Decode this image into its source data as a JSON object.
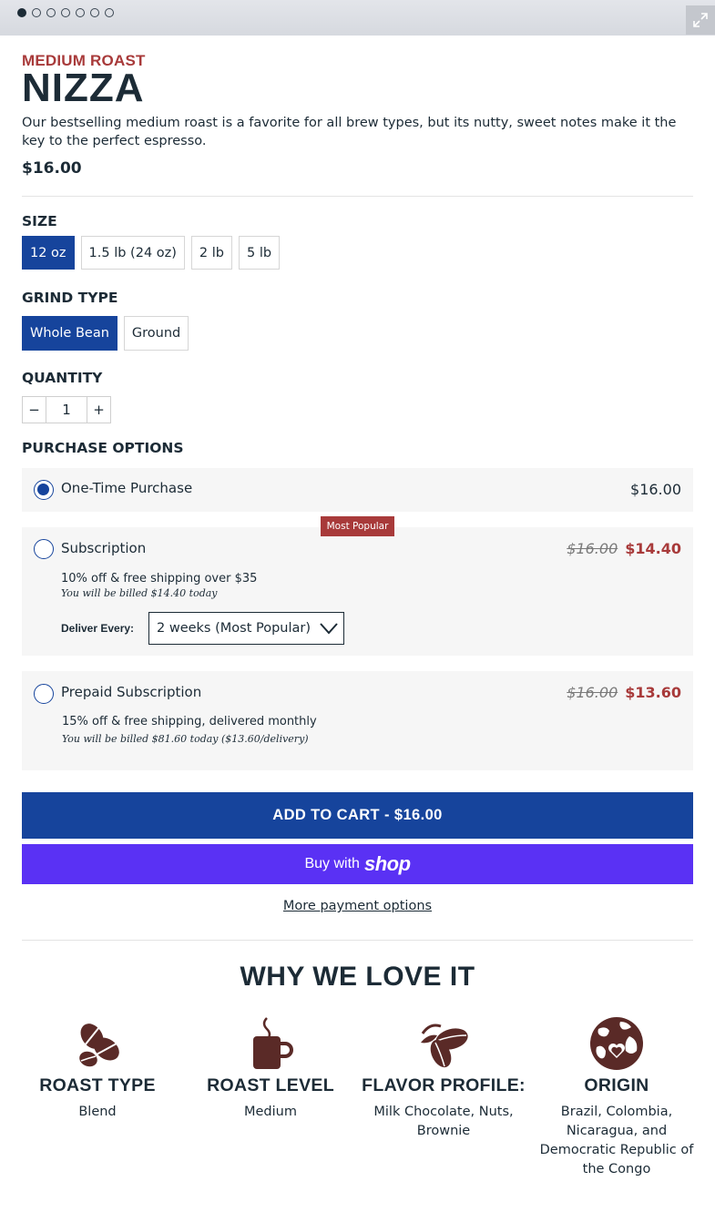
{
  "gallery": {
    "slide_count": 7,
    "active_slide": 1
  },
  "product": {
    "roast_label": "MEDIUM ROAST",
    "name": "NIZZA",
    "description": "Our bestselling medium roast is a favorite for all brew types, but its nutty, sweet notes make it the key to the perfect espresso.",
    "price": "$16.00"
  },
  "size": {
    "label": "SIZE",
    "options": [
      "12 oz",
      "1.5 lb (24 oz)",
      "2 lb",
      "5 lb"
    ],
    "selected": "12 oz"
  },
  "grind": {
    "label": "GRIND TYPE",
    "options": [
      "Whole Bean",
      "Ground"
    ],
    "selected": "Whole Bean"
  },
  "quantity": {
    "label": "QUANTITY",
    "minus": "−",
    "value": "1",
    "plus": "+"
  },
  "purchase": {
    "label": "PURCHASE OPTIONS",
    "one_time": {
      "title": "One-Time Purchase",
      "price": "$16.00",
      "selected": true
    },
    "subscription": {
      "badge": "Most Popular",
      "title": "Subscription",
      "original_price": "$16.00",
      "price": "$14.40",
      "note": "10% off & free shipping over $35",
      "billing": "You will be billed $14.40 today",
      "deliver_label": "Deliver Every:",
      "deliver_value": "2 weeks (Most Popular)"
    },
    "prepaid": {
      "title": "Prepaid Subscription",
      "original_price": "$16.00",
      "price": "$13.60",
      "note": "15% off & free shipping, delivered monthly",
      "billing": "You will be billed $81.60 today ($13.60/delivery)"
    }
  },
  "actions": {
    "add_to_cart": "ADD TO CART - $16.00",
    "buy_with": "Buy with",
    "shop_word": "shop",
    "more_payment": "More payment options"
  },
  "why": {
    "heading": "WHY WE LOVE IT",
    "features": [
      {
        "icon": "coffee-beans-icon",
        "title": "ROAST TYPE",
        "value": "Blend"
      },
      {
        "icon": "coffee-mug-icon",
        "title": "ROAST LEVEL",
        "value": "Medium"
      },
      {
        "icon": "cacao-pod-icon",
        "title": "FLAVOR PROFILE:",
        "value": "Milk Chocolate, Nuts, Brownie"
      },
      {
        "icon": "globe-icon",
        "title": "ORIGIN",
        "value": "Brazil, Colombia, Nicaragua, and Democratic Republic of the Congo"
      }
    ]
  },
  "colors": {
    "brand_blue": "#16449c",
    "accent_red": "#a83a3a",
    "shop_purple": "#5a31f4",
    "icon_brown": "#5a2a27",
    "text_dark": "#1c2b36"
  }
}
